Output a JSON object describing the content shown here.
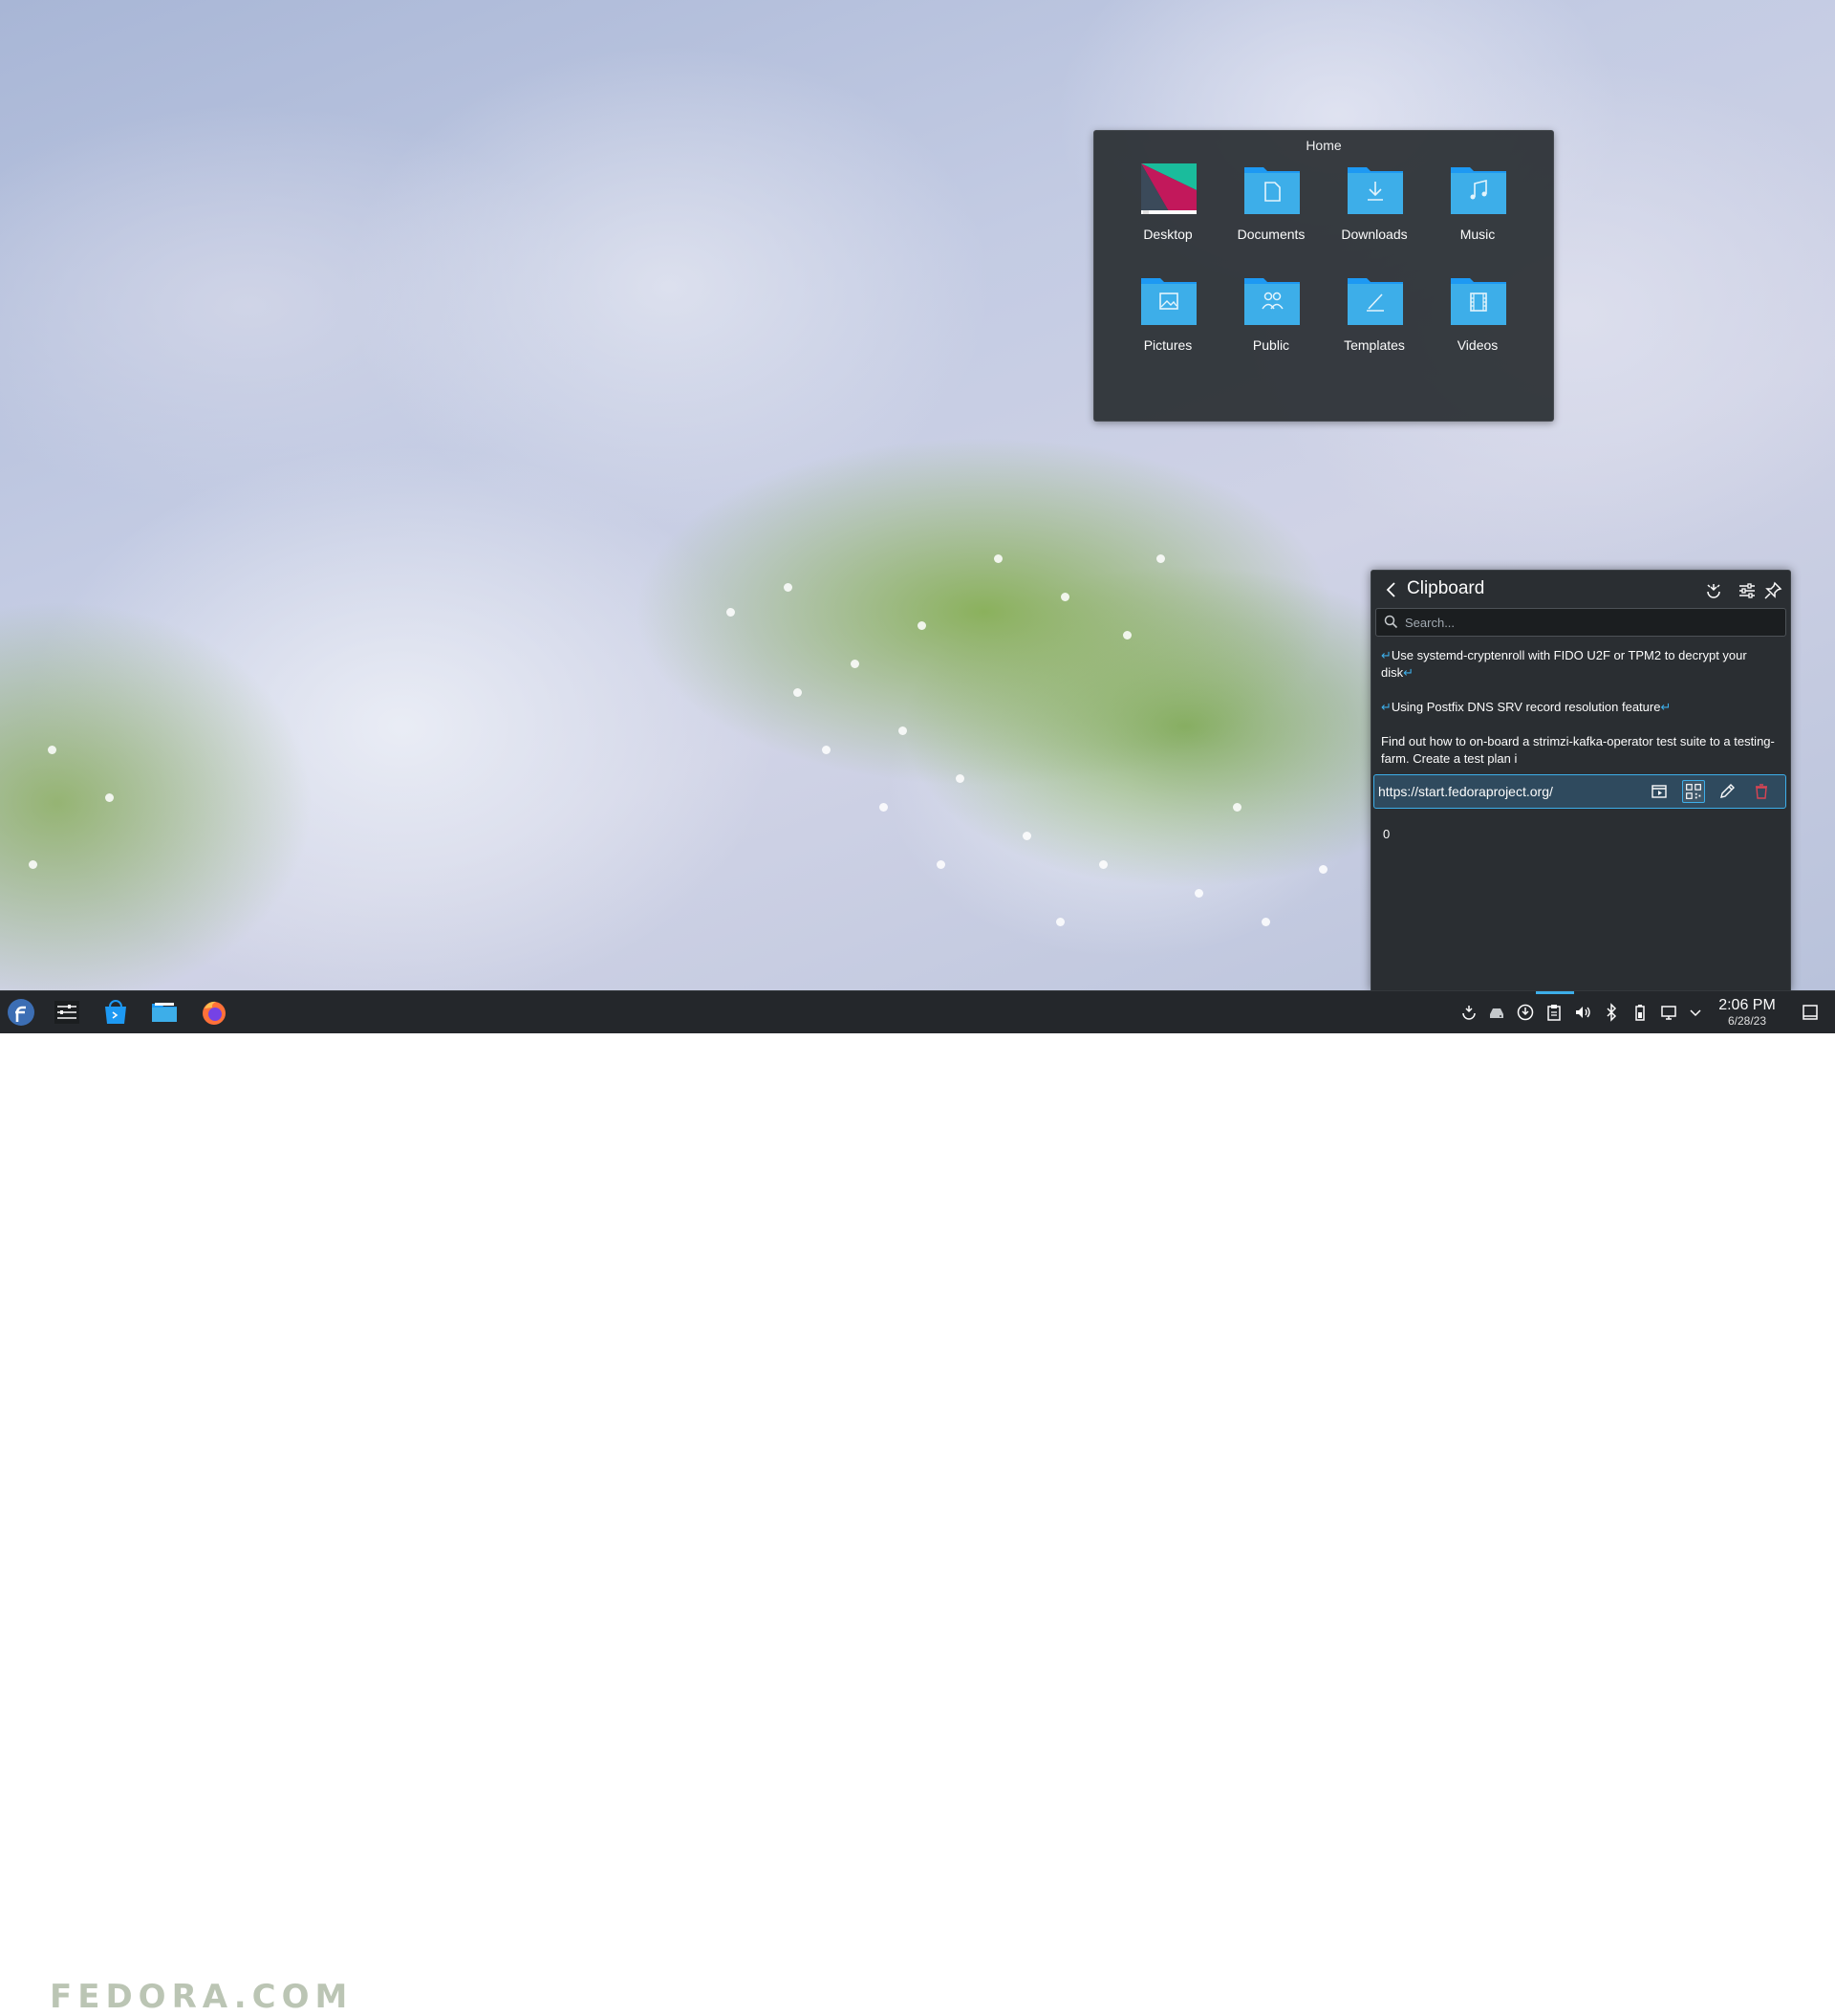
{
  "folder_view": {
    "title": "Home",
    "items": [
      {
        "label": "Desktop"
      },
      {
        "label": "Documents"
      },
      {
        "label": "Downloads"
      },
      {
        "label": "Music"
      },
      {
        "label": "Pictures"
      },
      {
        "label": "Public"
      },
      {
        "label": "Templates"
      },
      {
        "label": "Videos"
      }
    ],
    "folder_color": "#3daee9"
  },
  "clipboard": {
    "title": "Clipboard",
    "search_placeholder": "Search...",
    "entries": [
      {
        "text": "Use systemd-cryptenroll with FIDO U2F or TPM2 to decrypt your disk"
      },
      {
        "text": "Using Postfix DNS SRV record resolution feature"
      },
      {
        "text": "Find out how to on-board a strimzi-kafka-operator test suite to a testing-farm. Create a test plan i"
      }
    ],
    "selected_entry": "https://start.fedoraproject.org/",
    "last_entry": "0",
    "header_icons": [
      "configure-actions-icon",
      "settings-icon",
      "pin-icon"
    ],
    "row_icons": [
      "invoke-action-icon",
      "qr-code-icon",
      "edit-icon",
      "delete-icon"
    ],
    "accent": "#3daee9",
    "delete_color": "#da4453"
  },
  "taskbar": {
    "time": "2:06 PM",
    "date": "6/28/23",
    "watermark": "FEDORA.COM"
  }
}
